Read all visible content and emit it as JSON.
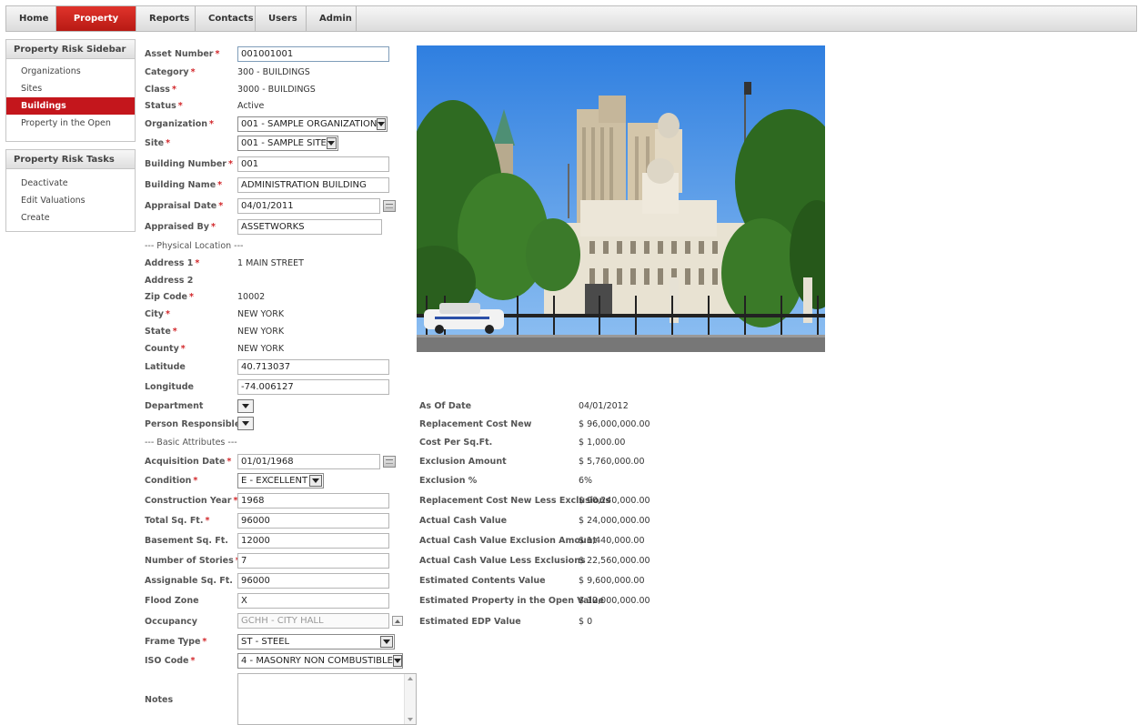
{
  "nav": {
    "tabs": [
      {
        "label": "Home"
      },
      {
        "label": "Property Risk"
      },
      {
        "label": "Reports"
      },
      {
        "label": "Contacts"
      },
      {
        "label": "Users"
      },
      {
        "label": "Admin"
      }
    ],
    "active_tab": "Property Risk",
    "accent_color": "#c4161c"
  },
  "sidebar": {
    "title": "Property Risk Sidebar",
    "items": [
      {
        "label": "Organizations"
      },
      {
        "label": "Sites"
      },
      {
        "label": "Buildings"
      },
      {
        "label": "Property in the Open"
      }
    ],
    "active_item": "Buildings"
  },
  "tasks": {
    "title": "Property Risk Tasks",
    "items": [
      {
        "label": "Deactivate"
      },
      {
        "label": "Edit Valuations"
      },
      {
        "label": "Create"
      }
    ]
  },
  "form": {
    "asset_number": {
      "label": "Asset Number",
      "value": "001001001"
    },
    "category": {
      "label": "Category",
      "value": "300 - BUILDINGS"
    },
    "class": {
      "label": "Class",
      "value": "3000 - BUILDINGS"
    },
    "status": {
      "label": "Status",
      "value": "Active"
    },
    "organization": {
      "label": "Organization",
      "value": "001 - SAMPLE ORGANIZATION"
    },
    "site": {
      "label": "Site",
      "value": "001 - SAMPLE SITE"
    },
    "building_number": {
      "label": "Building Number",
      "value": "001"
    },
    "building_name": {
      "label": "Building Name",
      "value": "ADMINISTRATION BUILDING"
    },
    "appraisal_date": {
      "label": "Appraisal Date",
      "value": "04/01/2011"
    },
    "appraised_by": {
      "label": "Appraised By",
      "value": "ASSETWORKS"
    },
    "physical_location_heading": "--- Physical Location ---",
    "address1": {
      "label": "Address 1",
      "value": "1 MAIN STREET"
    },
    "address2": {
      "label": "Address 2",
      "value": ""
    },
    "zip": {
      "label": "Zip Code",
      "value": "10002"
    },
    "city": {
      "label": "City",
      "value": "NEW YORK"
    },
    "state": {
      "label": "State",
      "value": "NEW YORK"
    },
    "county": {
      "label": "County",
      "value": "NEW YORK"
    },
    "latitude": {
      "label": "Latitude",
      "value": "40.713037"
    },
    "longitude": {
      "label": "Longitude",
      "value": "-74.006127"
    },
    "department": {
      "label": "Department",
      "value": ""
    },
    "person_responsible": {
      "label": "Person Responsible",
      "value": ""
    },
    "basic_attributes_heading": "--- Basic Attributes ---",
    "acquisition_date": {
      "label": "Acquisition Date",
      "value": "01/01/1968"
    },
    "condition": {
      "label": "Condition",
      "value": "E - EXCELLENT"
    },
    "construction_year": {
      "label": "Construction Year",
      "value": "1968"
    },
    "total_sqft": {
      "label": "Total Sq. Ft.",
      "value": "96000"
    },
    "basement_sqft": {
      "label": "Basement Sq. Ft.",
      "value": "12000"
    },
    "stories": {
      "label": "Number of Stories",
      "value": "7"
    },
    "assignable_sqft": {
      "label": "Assignable Sq. Ft.",
      "value": "96000"
    },
    "flood_zone": {
      "label": "Flood Zone",
      "value": "X"
    },
    "occupancy": {
      "label": "Occupancy",
      "value": "GCHH - CITY HALL"
    },
    "frame_type": {
      "label": "Frame Type",
      "value": "ST - STEEL"
    },
    "iso_code": {
      "label": "ISO Code",
      "value": "4 - MASONRY NON COMBUSTIBLE"
    },
    "notes": {
      "label": "Notes",
      "value": ""
    }
  },
  "valuation": [
    {
      "label": "As Of Date",
      "value": "04/01/2012"
    },
    {
      "label": "Replacement Cost New",
      "value": "$ 96,000,000.00"
    },
    {
      "label": "Cost Per Sq.Ft.",
      "value": "$ 1,000.00"
    },
    {
      "label": "Exclusion Amount",
      "value": "$ 5,760,000.00"
    },
    {
      "label": "Exclusion %",
      "value": "6%"
    },
    {
      "label": "Replacement Cost New Less Exclusions",
      "value": "$ 90,240,000.00"
    },
    {
      "label": "Actual Cash Value",
      "value": "$ 24,000,000.00"
    },
    {
      "label": "Actual Cash Value Exclusion Amount",
      "value": "$ 1,440,000.00"
    },
    {
      "label": "Actual Cash Value Less Exclusions",
      "value": "$ 22,560,000.00"
    },
    {
      "label": "Estimated Contents Value",
      "value": "$ 9,600,000.00"
    },
    {
      "label": "Estimated Property in the Open Value",
      "value": "$ 12,000,000.00"
    },
    {
      "label": "Estimated EDP Value",
      "value": "$ 0"
    }
  ]
}
